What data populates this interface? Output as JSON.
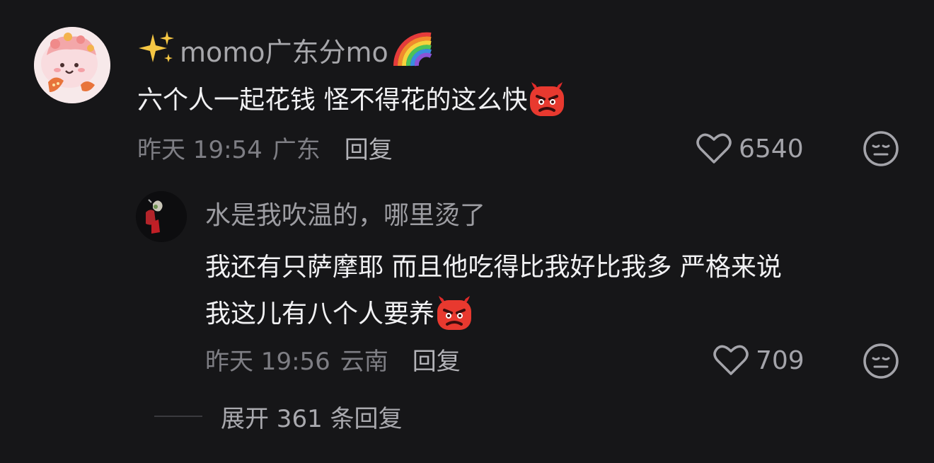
{
  "main_comment": {
    "username": "momo广东分mo",
    "text": "六个人一起花钱 怪不得花的这么快",
    "time": "昨天 19:54",
    "location": "广东",
    "reply_label": "回复",
    "likes": "6540",
    "icons": [
      "sparkle-emoji",
      "rainbow-emoji",
      "devil-emoji",
      "heart-icon",
      "dislike-face-icon"
    ]
  },
  "reply_comment": {
    "username": "水是我吹温的，哪里烫了",
    "text_line1": "我还有只萨摩耶  而且他吃得比我好比我多  严格来说",
    "text_line2": "我这儿有八个人要养",
    "time": "昨天 19:56",
    "location": "云南",
    "reply_label": "回复",
    "likes": "709"
  },
  "expand": {
    "label": "展开 361 条回复"
  },
  "colors": {
    "background": "#161618",
    "primary_text": "#f1f1f3",
    "secondary_text": "#7e7e84",
    "username_text": "#a7a7ab"
  }
}
